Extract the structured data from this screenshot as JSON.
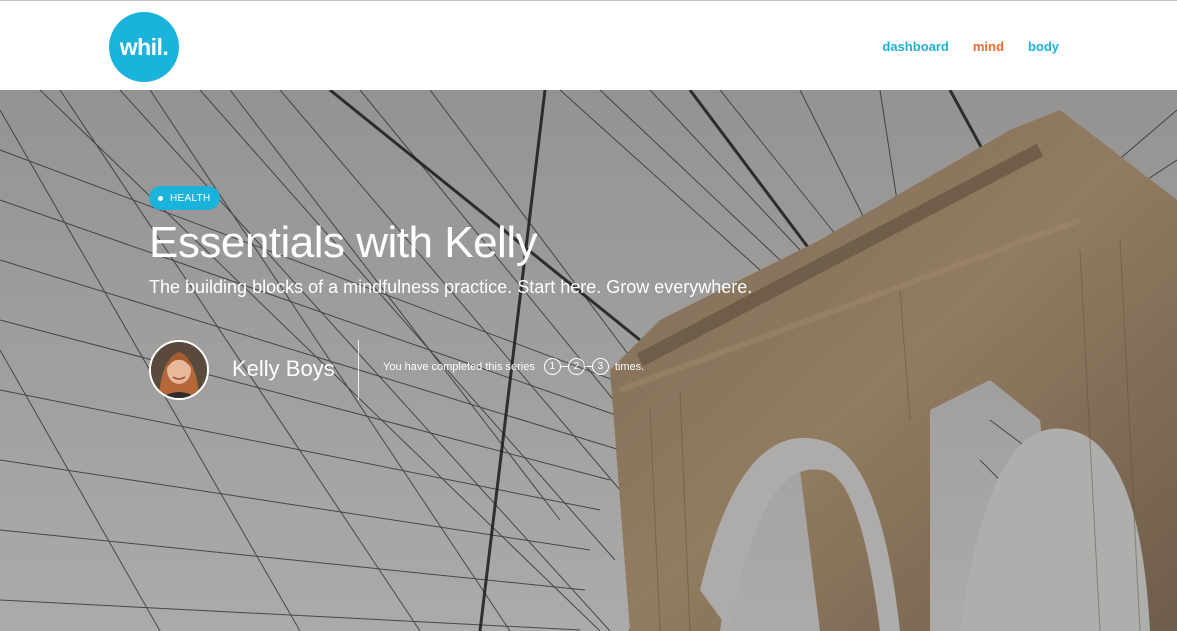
{
  "colors": {
    "brand": "#1ab3dc",
    "nav_active": "#f26b2c",
    "nav_default": "#1ab3dc",
    "badge": "#1ab3dc"
  },
  "header": {
    "logo_text": "whil.",
    "nav": [
      {
        "label": "dashboard",
        "active": false
      },
      {
        "label": "mind",
        "active": true
      },
      {
        "label": "body",
        "active": false
      }
    ]
  },
  "hero": {
    "category": "HEALTH",
    "title": "Essentials with Kelly",
    "subtitle": "The building blocks of a mindfulness practice. Start here. Grow everywhere.",
    "author": {
      "name": "Kelly Boys",
      "avatar_icon": "avatar-photo"
    },
    "progress": {
      "prefix": "You have completed this series",
      "steps": [
        "1",
        "2",
        "3"
      ],
      "suffix": "times."
    }
  }
}
